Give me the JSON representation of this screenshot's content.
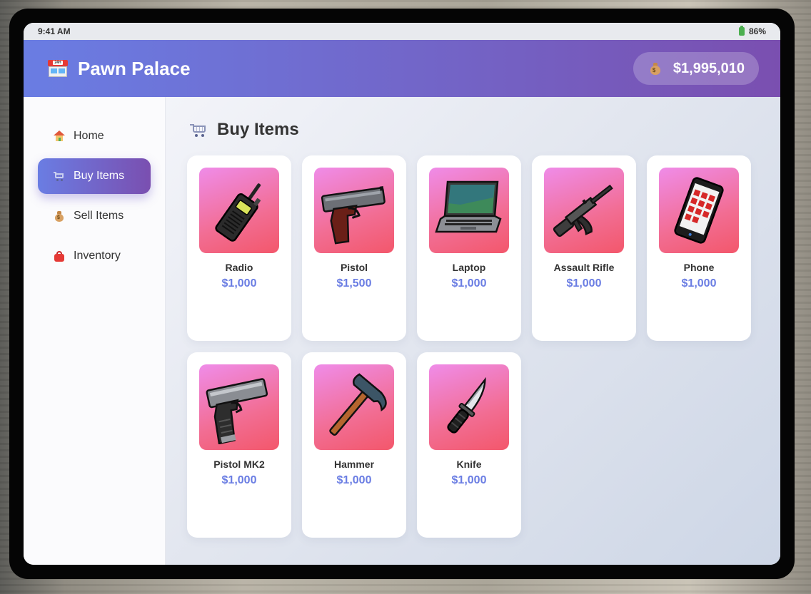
{
  "status_bar": {
    "time": "9:41 AM",
    "battery": "86%"
  },
  "header": {
    "title": "Pawn Palace",
    "balance": "$1,995,010",
    "store_sign": "24H"
  },
  "sidebar": {
    "items": [
      {
        "label": "Home",
        "icon": "home-icon",
        "active": false
      },
      {
        "label": "Buy Items",
        "icon": "cart-icon",
        "active": true
      },
      {
        "label": "Sell Items",
        "icon": "money-bag-icon",
        "active": false
      },
      {
        "label": "Inventory",
        "icon": "box-icon",
        "active": false
      }
    ]
  },
  "main": {
    "title": "Buy Items",
    "items": [
      {
        "name": "Radio",
        "price": "$1,000",
        "icon": "radio-icon"
      },
      {
        "name": "Pistol",
        "price": "$1,500",
        "icon": "pistol-icon"
      },
      {
        "name": "Laptop",
        "price": "$1,000",
        "icon": "laptop-icon"
      },
      {
        "name": "Assault Rifle",
        "price": "$1,000",
        "icon": "assault-rifle-icon"
      },
      {
        "name": "Phone",
        "price": "$1,000",
        "icon": "phone-icon"
      },
      {
        "name": "Pistol MK2",
        "price": "$1,000",
        "icon": "pistol-mk2-icon"
      },
      {
        "name": "Hammer",
        "price": "$1,000",
        "icon": "hammer-icon"
      },
      {
        "name": "Knife",
        "price": "$1,000",
        "icon": "knife-icon"
      }
    ]
  },
  "colors": {
    "header_start": "#6a7de3",
    "header_end": "#7a4fb0",
    "price": "#6a7de3",
    "thumb_start": "#ef8ce9",
    "thumb_end": "#f3576b"
  }
}
